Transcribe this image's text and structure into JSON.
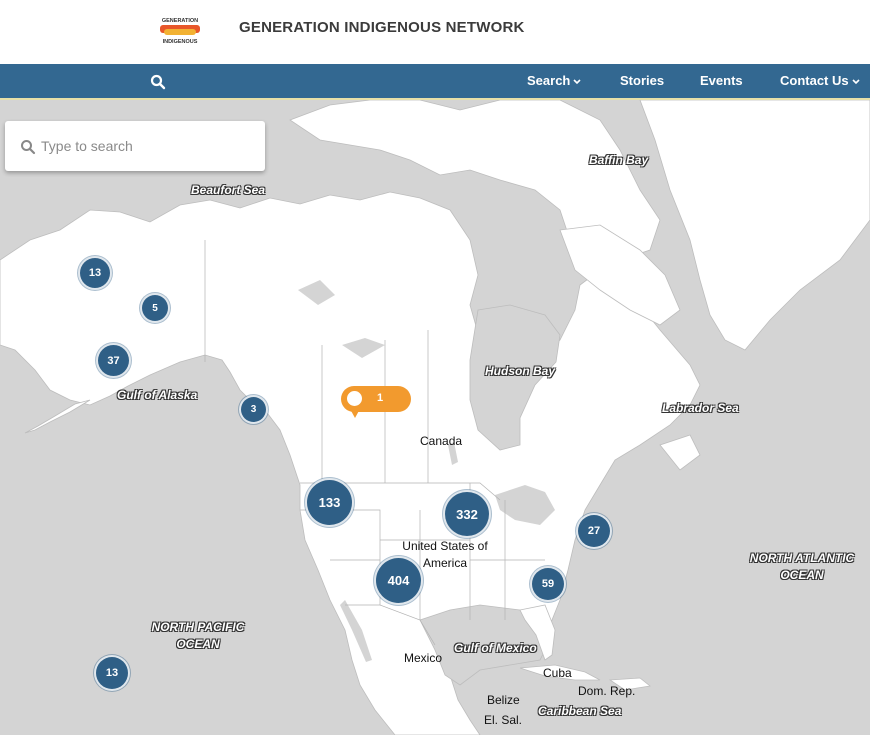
{
  "header": {
    "logo_text_top": "GENERATION",
    "logo_text_bottom": "INDIGENOUS",
    "title": "GENERATION INDIGENOUS NETWORK"
  },
  "nav": {
    "search_icon": "search-icon",
    "items": [
      {
        "label": "Search",
        "dropdown": true
      },
      {
        "label": "Stories",
        "dropdown": false
      },
      {
        "label": "Events",
        "dropdown": false
      },
      {
        "label": "Contact Us",
        "dropdown": true
      }
    ]
  },
  "map_search": {
    "placeholder": "Type to search",
    "icon": "search-icon"
  },
  "map_labels": {
    "beaufort": "Beaufort Sea",
    "baffin": "Baffin Bay",
    "hudson": "Hudson Bay",
    "labrador": "Labrador Sea",
    "alaska_gulf": "Gulf of Alaska",
    "canada": "Canada",
    "usa": "United States of America",
    "npacific": "NORTH PACIFIC OCEAN",
    "natlantic": "NORTH ATLANTIC OCEAN",
    "mexico": "Mexico",
    "gulf_mexico": "Gulf of Mexico",
    "cuba": "Cuba",
    "dom_rep": "Dom. Rep.",
    "belize": "Belize",
    "el_sal": "El. Sal.",
    "caribbean": "Caribbean Sea"
  },
  "clusters": [
    {
      "count": "13"
    },
    {
      "count": "5"
    },
    {
      "count": "37"
    },
    {
      "count": "3"
    },
    {
      "count": "133"
    },
    {
      "count": "332"
    },
    {
      "count": "27"
    },
    {
      "count": "404"
    },
    {
      "count": "59"
    },
    {
      "count": "13"
    }
  ],
  "marker": {
    "count": "1"
  },
  "colors": {
    "nav_bg": "#336891",
    "cluster": "#2f5f86",
    "marker": "#f29a2e",
    "water": "#d4d4d4",
    "land": "#ffffff"
  }
}
